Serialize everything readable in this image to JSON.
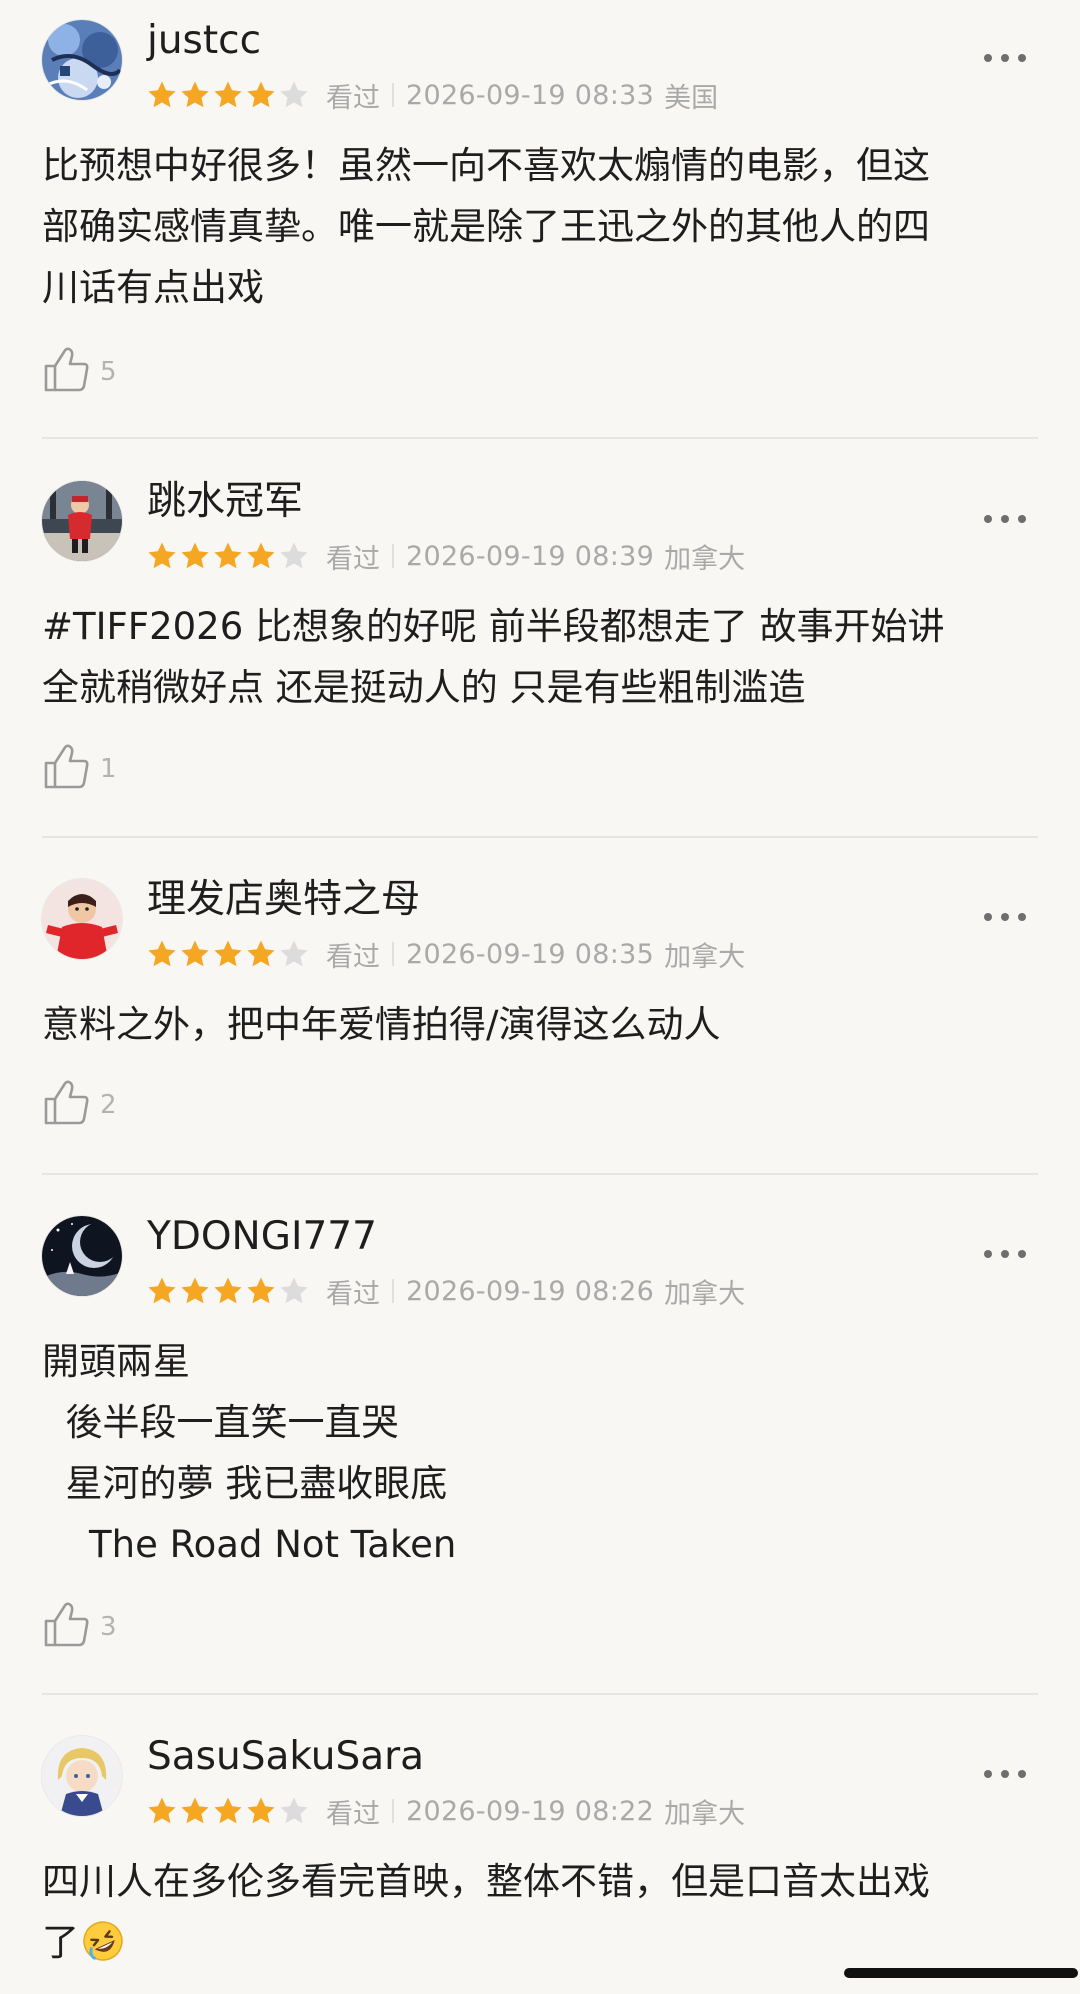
{
  "colors": {
    "background": "#f8f7f4",
    "star_filled": "#f5a623",
    "star_empty": "#dcdcdc",
    "meta_text": "#a9a9a9"
  },
  "reviews": [
    {
      "username": "justcc",
      "rating": 4,
      "watched": "看过",
      "datetime": "2026-09-19 08:33",
      "location": "美国",
      "lines": [
        "比预想中好很多！虽然一向不喜欢太煽情的电影，但这",
        "部确实感情真挚。唯一就是除了王迅之外的其他人的四",
        "川话有点出戏"
      ],
      "likes": "5",
      "avatar_icon": "avatar-blue-illustration-icon"
    },
    {
      "username": "跳水冠军",
      "rating": 4,
      "watched": "看过",
      "datetime": "2026-09-19 08:39",
      "location": "加拿大",
      "lines": [
        "#TIFF2026 比想象的好呢 前半段都想走了 故事开始讲",
        "全就稍微好点 还是挺动人的 只是有些粗制滥造"
      ],
      "likes": "1",
      "avatar_icon": "avatar-child-red-coat-icon"
    },
    {
      "username": "理发店奥特之母",
      "rating": 4,
      "watched": "看过",
      "datetime": "2026-09-19 08:35",
      "location": "加拿大",
      "lines": [
        "意料之外，把中年爱情拍得/演得这么动人"
      ],
      "likes": "2",
      "avatar_icon": "avatar-red-figure-icon"
    },
    {
      "username": "YDONGI777",
      "rating": 4,
      "watched": "看过",
      "datetime": "2026-09-19 08:26",
      "location": "加拿大",
      "lines": [
        "開頭兩星",
        "  後半段一直笑一直哭",
        "  星河的夢 我已盡收眼底",
        "    The Road Not Taken"
      ],
      "likes": "3",
      "avatar_icon": "avatar-night-sky-icon"
    },
    {
      "username": "SasuSakuSara",
      "rating": 4,
      "watched": "看过",
      "datetime": "2026-09-19 08:22",
      "location": "加拿大",
      "lines": [
        "四川人在多伦多看完首映，整体不错，但是口音太出戏",
        "了"
      ],
      "likes": "",
      "avatar_icon": "avatar-anime-character-icon",
      "emoji": "rolling-on-floor-laughing-icon"
    }
  ]
}
